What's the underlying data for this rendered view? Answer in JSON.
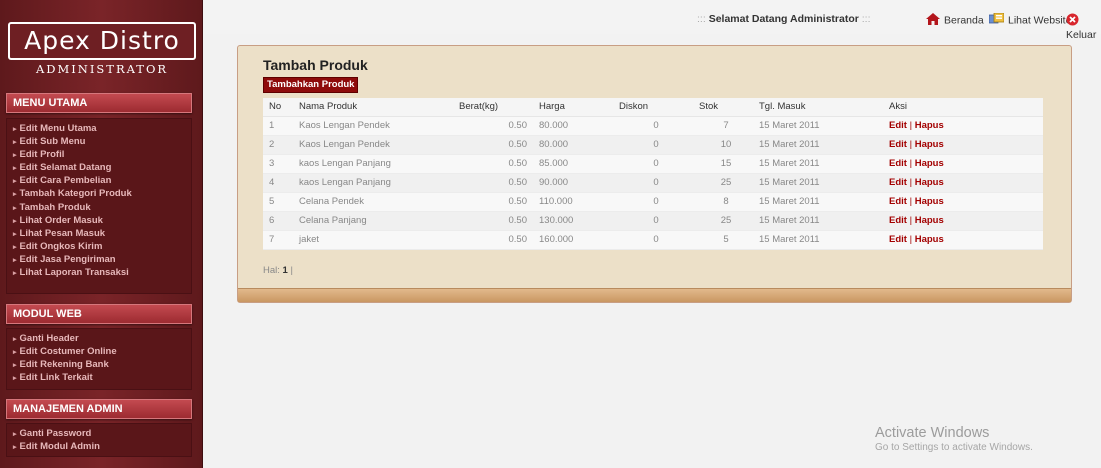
{
  "logo": {
    "title": "Apex Distro",
    "subtitle": "ADMINISTRATOR"
  },
  "menu_utama": {
    "heading": "MENU UTAMA",
    "items": [
      "Edit Menu Utama",
      "Edit Sub Menu",
      "Edit Profil",
      "Edit Selamat Datang",
      "Edit Cara Pembelian",
      "Tambah Kategori Produk",
      "Tambah Produk",
      "Lihat Order Masuk",
      "Lihat Pesan Masuk",
      "Edit Ongkos Kirim",
      "Edit Jasa Pengiriman",
      "Lihat Laporan Transaksi"
    ]
  },
  "modul_web": {
    "heading": "MODUL WEB",
    "items": [
      "Ganti Header",
      "Edit Costumer Online",
      "Edit Rekening Bank",
      "Edit Link Terkait"
    ]
  },
  "manajemen_admin": {
    "heading": "MANAJEMEN ADMIN",
    "items": [
      "Ganti Password",
      "Edit Modul Admin"
    ]
  },
  "topbar": {
    "dots_left": ":::",
    "welcome": "Selamat Datang Administrator",
    "dots_right": ":::",
    "beranda": "Beranda",
    "lihat_website": "Lihat Website",
    "keluar": "Keluar"
  },
  "content": {
    "title": "Tambah Produk",
    "add_button": "Tambahkan Produk",
    "columns": [
      "No",
      "Nama Produk",
      "Berat(kg)",
      "Harga",
      "Diskon",
      "Stok",
      "Tgl. Masuk",
      "Aksi"
    ],
    "rows": [
      [
        "1",
        "Kaos Lengan Pendek",
        "0.50",
        "80.000",
        "0",
        "7",
        "15 Maret 2011"
      ],
      [
        "2",
        "Kaos Lengan Pendek",
        "0.50",
        "80.000",
        "0",
        "10",
        "15 Maret 2011"
      ],
      [
        "3",
        "kaos Lengan Panjang",
        "0.50",
        "85.000",
        "0",
        "15",
        "15 Maret 2011"
      ],
      [
        "4",
        "kaos Lengan Panjang",
        "0.50",
        "90.000",
        "0",
        "25",
        "15 Maret 2011"
      ],
      [
        "5",
        "Celana Pendek",
        "0.50",
        "110.000",
        "0",
        "8",
        "15 Maret 2011"
      ],
      [
        "6",
        "Celana Panjang",
        "0.50",
        "130.000",
        "0",
        "25",
        "15 Maret 2011"
      ],
      [
        "7",
        "jaket",
        "0.50",
        "160.000",
        "0",
        "5",
        "15 Maret 2011"
      ]
    ],
    "action_edit": "Edit",
    "action_sep": "|",
    "action_delete": "Hapus",
    "pager_label": "Hal:",
    "pager_current": "1",
    "pager_sep": "|"
  },
  "watermark": {
    "line1": "Activate Windows",
    "line2": "Go to Settings to activate Windows."
  },
  "colors": {
    "sidebar": "#6e1f23",
    "menu_header": "#9d2b31",
    "panel": "#ece0c8",
    "action_link": "#a30000"
  }
}
